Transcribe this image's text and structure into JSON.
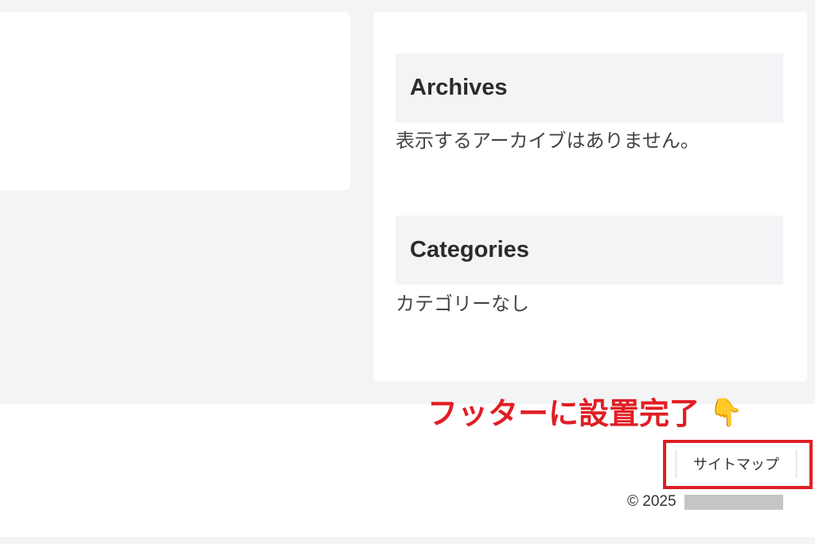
{
  "sidebar": {
    "archives": {
      "title": "Archives",
      "body": "表示するアーカイブはありません。"
    },
    "categories": {
      "title": "Categories",
      "body": "カテゴリーなし"
    }
  },
  "annotation": {
    "text": "フッターに設置完了",
    "icon": "pointing-down-hand-icon",
    "glyph": "👇",
    "color": "#e01e24"
  },
  "footer": {
    "sitemap_label": "サイトマップ",
    "copyright_text": "© 2025"
  },
  "colors": {
    "page_background": "#f3f4f6",
    "card_background": "#ffffff",
    "widget_title_background": "#f3f4f6",
    "highlight": "#e01e24"
  }
}
